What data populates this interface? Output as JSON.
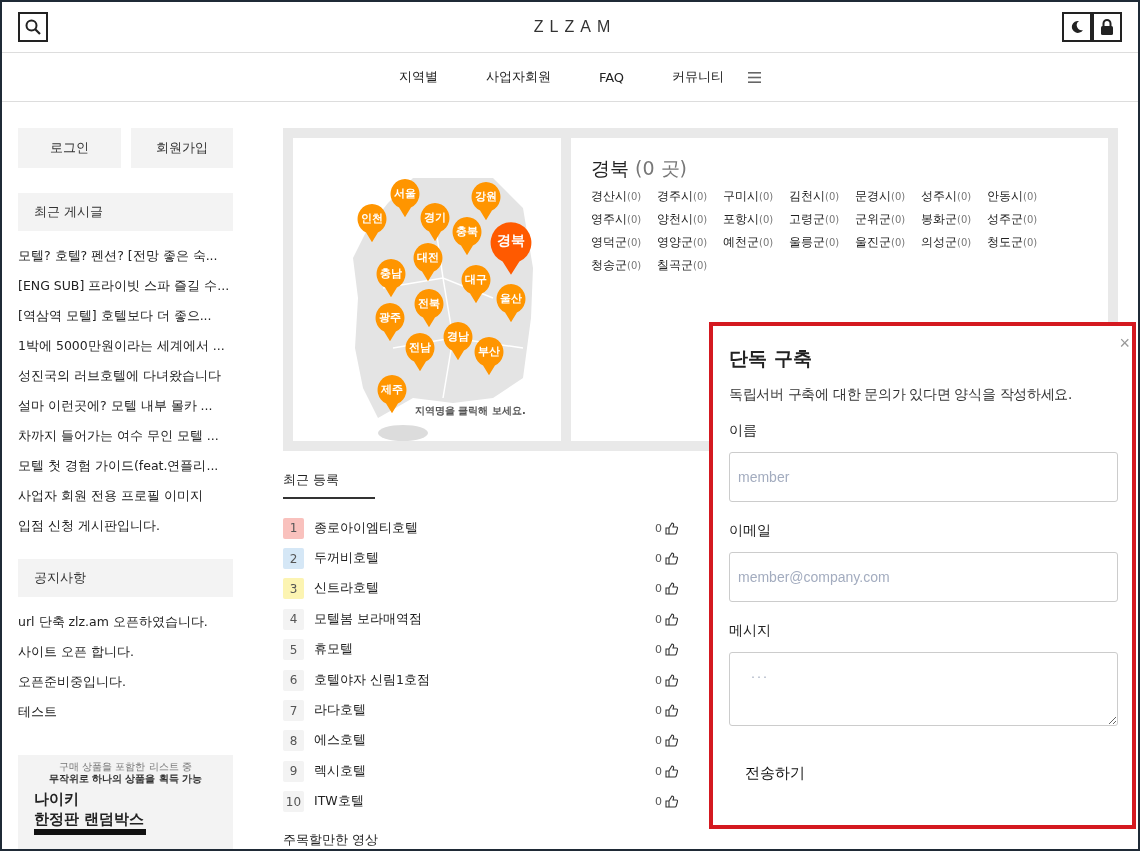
{
  "header": {
    "logo": "ZLZAM"
  },
  "nav": [
    {
      "label": "지역별"
    },
    {
      "label": "사업자회원"
    },
    {
      "label": "FAQ"
    },
    {
      "label": "커뮤니티"
    }
  ],
  "sidebar": {
    "buttons": [
      "로그인",
      "회원가입"
    ],
    "recent_posts": {
      "title": "최근 게시글",
      "items": [
        "모텔? 호텔? 펜션? [전망 좋은 숙...",
        "[ENG SUB] 프라이빗 스파 즐길 수...",
        "[역삼역 모텔] 호텔보다 더 좋으...",
        "1박에 5000만원이라는 세계에서 ...",
        "성진국의 러브호텔에 다녀왔습니다",
        "설마 이런곳에? 모텔 내부 몰카 ...",
        "차까지 들어가는 여수 무인 모텔 ...",
        "모텔 첫 경험 가이드(feat.연플리...",
        "사업자 회원 전용 프로필 이미지",
        "입점 신청 게시판입니다."
      ]
    },
    "notices": {
      "title": "공지사항",
      "items": [
        "url 단축 zlz.am 오픈하였습니다.",
        "사이트 오픈 합니다.",
        "오픈준비중입니다.",
        "테스트"
      ]
    },
    "ad": {
      "lines": [
        "구매 상품을 포함한 리스트 중",
        "무작위로 하나의 상품을 획득 가능"
      ],
      "headline": [
        "나이키",
        "한정판 랜덤박스"
      ]
    }
  },
  "map": {
    "pins": [
      {
        "label": "서울",
        "selected": false
      },
      {
        "label": "강원",
        "selected": false
      },
      {
        "label": "인천",
        "selected": false
      },
      {
        "label": "경기",
        "selected": false
      },
      {
        "label": "충북",
        "selected": false
      },
      {
        "label": "경북",
        "selected": true
      },
      {
        "label": "대전",
        "selected": false
      },
      {
        "label": "충남",
        "selected": false
      },
      {
        "label": "대구",
        "selected": false
      },
      {
        "label": "울산",
        "selected": false
      },
      {
        "label": "전북",
        "selected": false
      },
      {
        "label": "광주",
        "selected": false
      },
      {
        "label": "경남",
        "selected": false
      },
      {
        "label": "전남",
        "selected": false
      },
      {
        "label": "부산",
        "selected": false
      },
      {
        "label": "제주",
        "selected": false
      }
    ],
    "hint": "지역명을 클릭해 보세요."
  },
  "region": {
    "name": "경북",
    "count": "(0 곳)",
    "districts": [
      {
        "name": "경산시",
        "count": "(0)"
      },
      {
        "name": "경주시",
        "count": "(0)"
      },
      {
        "name": "구미시",
        "count": "(0)"
      },
      {
        "name": "김천시",
        "count": "(0)"
      },
      {
        "name": "문경시",
        "count": "(0)"
      },
      {
        "name": "성주시",
        "count": "(0)"
      },
      {
        "name": "안동시",
        "count": "(0)"
      },
      {
        "name": "영주시",
        "count": "(0)"
      },
      {
        "name": "양천시",
        "count": "(0)"
      },
      {
        "name": "포항시",
        "count": "(0)"
      },
      {
        "name": "고령군",
        "count": "(0)"
      },
      {
        "name": "군위군",
        "count": "(0)"
      },
      {
        "name": "봉화군",
        "count": "(0)"
      },
      {
        "name": "성주군",
        "count": "(0)"
      },
      {
        "name": "영덕군",
        "count": "(0)"
      },
      {
        "name": "영양군",
        "count": "(0)"
      },
      {
        "name": "예천군",
        "count": "(0)"
      },
      {
        "name": "울릉군",
        "count": "(0)"
      },
      {
        "name": "울진군",
        "count": "(0)"
      },
      {
        "name": "의성군",
        "count": "(0)"
      },
      {
        "name": "청도군",
        "count": "(0)"
      },
      {
        "name": "청송군",
        "count": "(0)"
      },
      {
        "name": "칠곡군",
        "count": "(0)"
      }
    ]
  },
  "recent": {
    "title": "최근 등록",
    "items": [
      {
        "rank": "1",
        "name": "종로아이엠티호텔",
        "likes": "0",
        "color": "#f9c1bd"
      },
      {
        "rank": "2",
        "name": "두꺼비호텔",
        "likes": "0",
        "color": "#d5e7f6"
      },
      {
        "rank": "3",
        "name": "신트라호텔",
        "likes": "0",
        "color": "#fcf4b2"
      },
      {
        "rank": "4",
        "name": "모텔봄 보라매역점",
        "likes": "0",
        "color": "#f3f3f3"
      },
      {
        "rank": "5",
        "name": "휴모텔",
        "likes": "0",
        "color": "#f3f3f3"
      },
      {
        "rank": "6",
        "name": "호텔야자 신림1호점",
        "likes": "0",
        "color": "#f3f3f3"
      },
      {
        "rank": "7",
        "name": "라다호텔",
        "likes": "0",
        "color": "#f3f3f3"
      },
      {
        "rank": "8",
        "name": "에스호텔",
        "likes": "0",
        "color": "#f3f3f3"
      },
      {
        "rank": "9",
        "name": "렉시호텔",
        "likes": "0",
        "color": "#f3f3f3"
      },
      {
        "rank": "10",
        "name": "ITW호텔",
        "likes": "0",
        "color": "#f3f3f3"
      }
    ]
  },
  "videos": {
    "title": "주목할만한 영상"
  },
  "modal": {
    "title": "단독 구축",
    "description": "독립서버 구축에 대한 문의가 있다면 양식을 작성하세요.",
    "close": "×",
    "fields": [
      {
        "label": "이름",
        "kind": "input",
        "placeholder": "member"
      },
      {
        "label": "이메일",
        "kind": "input",
        "placeholder": "member@company.com"
      },
      {
        "label": "메시지",
        "kind": "textarea",
        "placeholder": "..."
      }
    ],
    "submit": "전송하기"
  }
}
